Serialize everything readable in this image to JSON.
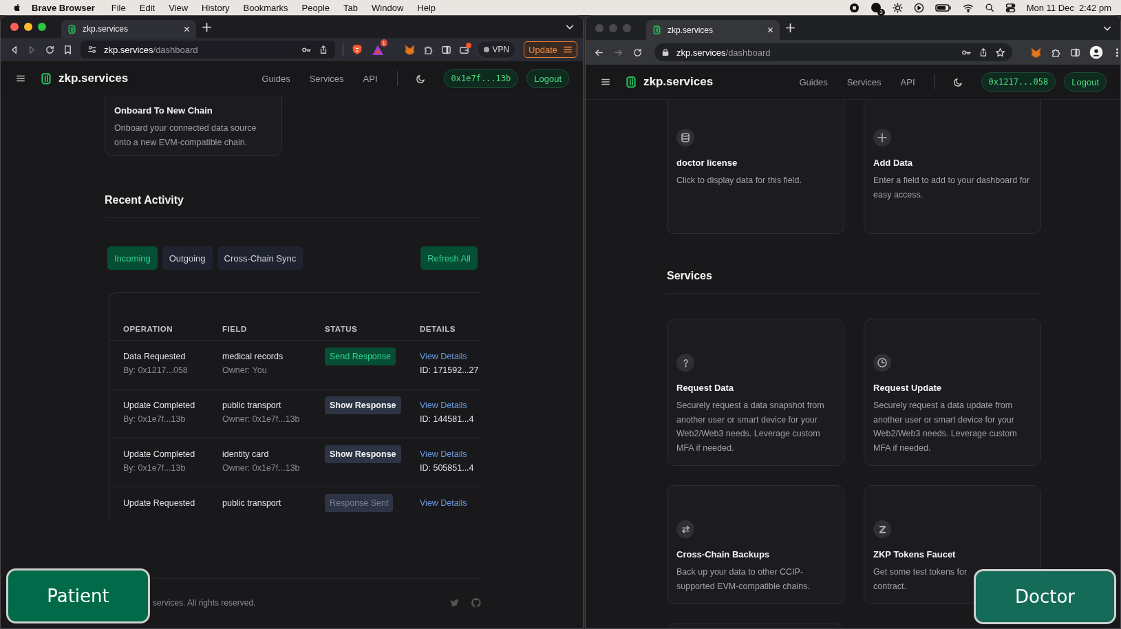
{
  "menu_bar": {
    "app_name": "Brave Browser",
    "menus": [
      "File",
      "Edit",
      "View",
      "History",
      "Bookmarks",
      "People",
      "Tab",
      "Window",
      "Help"
    ],
    "status_badge": "3",
    "clock": "Mon 11 Dec  2:42 pm"
  },
  "windows": [
    {
      "kind": "brave",
      "focused": true,
      "tab_title": "zkp.services",
      "url_host": "zkp.services",
      "url_path": "/dashboard",
      "rewards_badge": "1",
      "vpn_label": "VPN",
      "update_label": "Update",
      "app": {
        "brand": "zkp.services",
        "nav": [
          "Guides",
          "Services",
          "API"
        ],
        "account": "0x1e7f...13b",
        "logout": "Logout"
      },
      "content": {
        "kind": "activity",
        "top_card": {
          "title": "Onboard To New Chain",
          "description": [
            "Onboard your connected data source",
            "onto a new EVM-compatible chain."
          ]
        },
        "heading": "Recent Activity",
        "tabs": [
          {
            "label": "Incoming",
            "selected": true
          },
          {
            "label": "Outgoing",
            "selected": false
          },
          {
            "label": "Cross-Chain Sync",
            "selected": false
          }
        ],
        "refresh": "Refresh All",
        "columns": [
          "OPERATION",
          "FIELD",
          "STATUS",
          "DETAILS"
        ],
        "rows": [
          {
            "operation": "Data Requested",
            "by": "By: 0x1217...058",
            "field": "medical records",
            "owner": "Owner: You",
            "status": {
              "kind": "send",
              "label": "Send Response"
            },
            "link": "View Details",
            "id": "ID: 171592...27"
          },
          {
            "operation": "Update Completed",
            "by": "By: 0x1e7f...13b",
            "field": "public transport",
            "owner": "Owner: 0x1e7f...13b",
            "status": {
              "kind": "show",
              "label": "Show Response"
            },
            "link": "View Details",
            "id": "ID: 144581...4"
          },
          {
            "operation": "Update Completed",
            "by": "By: 0x1e7f...13b",
            "field": "identity card",
            "owner": "Owner: 0x1e7f...13b",
            "status": {
              "kind": "show",
              "label": "Show Response"
            },
            "link": "View Details",
            "id": "ID: 505851...4"
          },
          {
            "operation": "Update Requested",
            "field": "public transport",
            "status": {
              "kind": "sent",
              "label": "Response Sent"
            },
            "link": "View Details"
          }
        ],
        "footer": "services. All rights reserved."
      }
    },
    {
      "kind": "chrome",
      "focused": false,
      "tab_title": "zkp.services",
      "url_host": "zkp.services",
      "url_path": "/dashboard",
      "app": {
        "brand": "zkp.services",
        "nav": [
          "Guides",
          "Services",
          "API"
        ],
        "account": "0x1217...058",
        "logout": "Logout"
      },
      "content": {
        "kind": "dashboard",
        "top_cards": [
          {
            "kind": "database",
            "title": "doctor license",
            "description": [
              "Click to display data for this field."
            ]
          },
          {
            "kind": "plus",
            "title": "Add Data",
            "description": [
              "Enter a field to add to your dashboard for",
              "easy access."
            ]
          }
        ],
        "heading": "Services",
        "cards": [
          {
            "kind": "question",
            "title": "Request Data",
            "description": [
              "Securely request a data snapshot from",
              "another user or smart device for your",
              "Web2/Web3 needs. Leverage custom",
              "MFA if needed."
            ]
          },
          {
            "kind": "clock",
            "title": "Request Update",
            "description": [
              "Securely request a data update from",
              "another user or smart device for your",
              "Web2/Web3 needs. Leverage custom",
              "MFA if needed."
            ]
          },
          {
            "kind": "swap",
            "title": "Cross-Chain Backups",
            "description": [
              "Back up your data to other CCIP-",
              "supported EVM-compatible chains."
            ]
          },
          {
            "kind": "zigzag",
            "title": "ZKP Tokens Faucet",
            "description": [
              "Get some test tokens for",
              "contract."
            ]
          }
        ]
      }
    }
  ],
  "role_badges": [
    "Patient",
    "Doctor"
  ]
}
